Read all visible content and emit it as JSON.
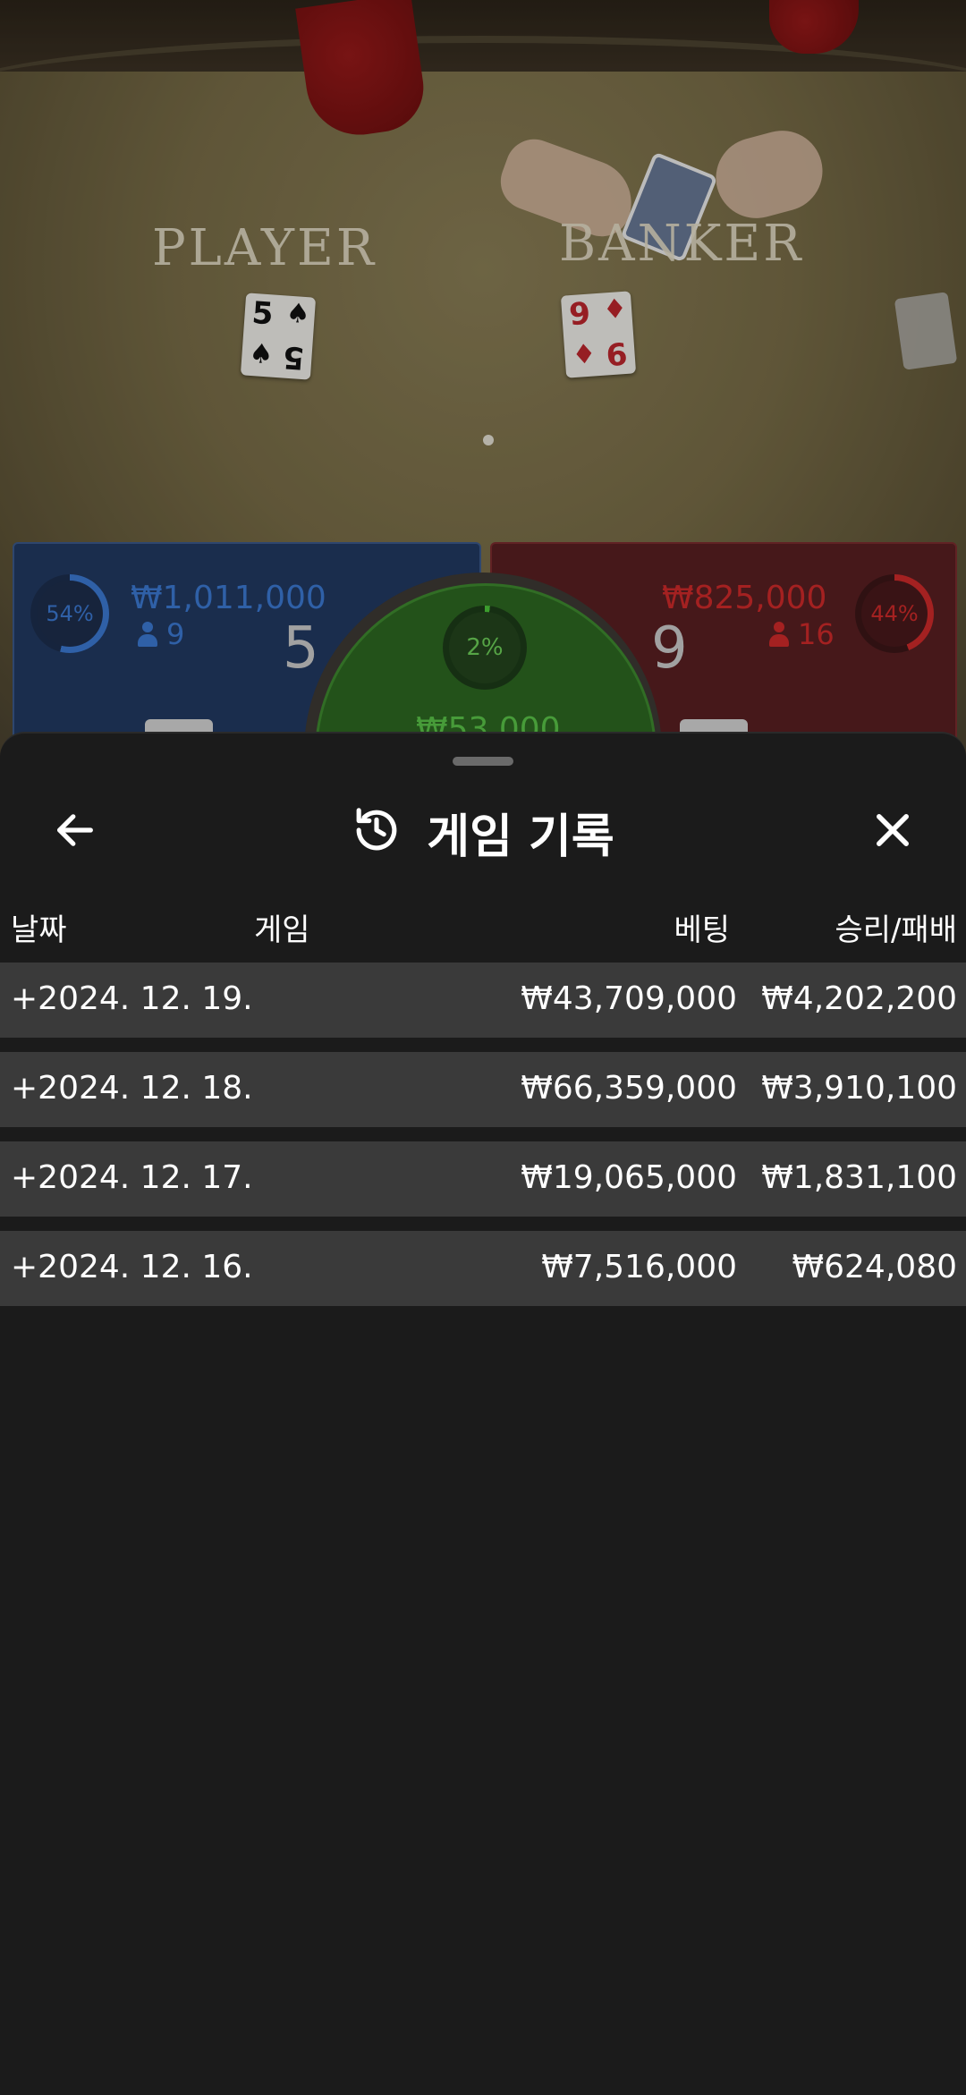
{
  "game_table": {
    "player_label": "PLAYER",
    "banker_label": "BANKER",
    "player_card": {
      "rank": "5",
      "suit": "♠"
    },
    "banker_card": {
      "rank": "9",
      "suit": "♦"
    }
  },
  "player_panel": {
    "percent": "54%",
    "amount": "₩1,011,000",
    "bettors": "9",
    "score": "5",
    "color": "#3d7bd6"
  },
  "tie_panel": {
    "percent": "2%",
    "amount": "₩53,000",
    "color": "#4ec93c"
  },
  "banker_panel": {
    "percent": "44%",
    "amount": "₩825,000",
    "bettors": "16",
    "score": "9",
    "color": "#d22b2b"
  },
  "sheet": {
    "title": "게임 기록",
    "back_icon": "arrow-left-icon",
    "history_icon": "history-icon",
    "close_icon": "close-icon",
    "columns": {
      "date": "날짜",
      "game": "게임",
      "bet": "베팅",
      "result": "승리/패배"
    },
    "rows": [
      {
        "date": "+2024. 12. 19.",
        "bet": "₩43,709,000",
        "result": "₩4,202,200"
      },
      {
        "date": "+2024. 12. 18.",
        "bet": "₩66,359,000",
        "result": "₩3,910,100"
      },
      {
        "date": "+2024. 12. 17.",
        "bet": "₩19,065,000",
        "result": "₩1,831,100"
      },
      {
        "date": "+2024. 12. 16.",
        "bet": "₩7,516,000",
        "result": "₩624,080"
      }
    ]
  }
}
